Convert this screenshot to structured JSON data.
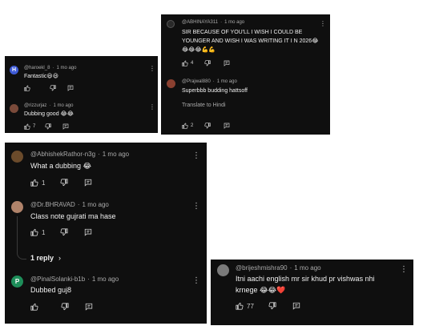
{
  "panel_a": {
    "comments": [
      {
        "handle": "@haroekl_8",
        "time": "1 mo ago",
        "text": "Fantastic😃😃",
        "avatar_letter": "H",
        "avatar_color": "#3f5bd6"
      },
      {
        "handle": "@rizzurjaz",
        "time": "1 mo ago",
        "text": "Dubbing  good 😂😂",
        "likes": "7",
        "avatar_color": "#7a4a3a"
      }
    ]
  },
  "panel_b": {
    "comments": [
      {
        "handle": "@ABHINAYA311",
        "time": "1 mo ago",
        "text": "SIR BECAUSE OF YOU'LL I WISH I COULD BE YOUNGER AND WISH I WAS WRITING IT I N 2026😂😂😂😂💪💪",
        "likes": "4",
        "avatar_color": "#2a2a2a"
      },
      {
        "handle": "@Prajwal880",
        "time": "1 mo ago",
        "text": "Superbbb budding hattsoff",
        "translate": "Translate to Hindi",
        "likes": "2",
        "avatar_color": "#8a4030"
      }
    ]
  },
  "panel_c": {
    "comments": [
      {
        "handle": "@AbhishekRathor-n3g",
        "time": "1 mo ago",
        "text": "What a dubbing 😂",
        "likes": "1",
        "avatar_color": "#6b4b2b"
      },
      {
        "handle": "@Dr.BHRAVAD",
        "time": "1 mo ago",
        "text": "Class note gujrati ma hase",
        "likes": "1",
        "avatar_color": "#b0836a"
      },
      {
        "handle": "@PinalSolanki-b1b",
        "time": "1 mo ago",
        "text": "Dubbed guj8",
        "avatar_letter": "P",
        "avatar_color": "#1e8e5a"
      }
    ],
    "replies_label": "1 reply"
  },
  "panel_d": {
    "comments": [
      {
        "handle": "@brijeshmishra90",
        "time": "1 mo ago",
        "text": "Itni aachi english mr sir khud pr vishwas nhi krnege 😂😂❤️",
        "likes": "77",
        "avatar_color": "#7a7a7a"
      }
    ]
  }
}
